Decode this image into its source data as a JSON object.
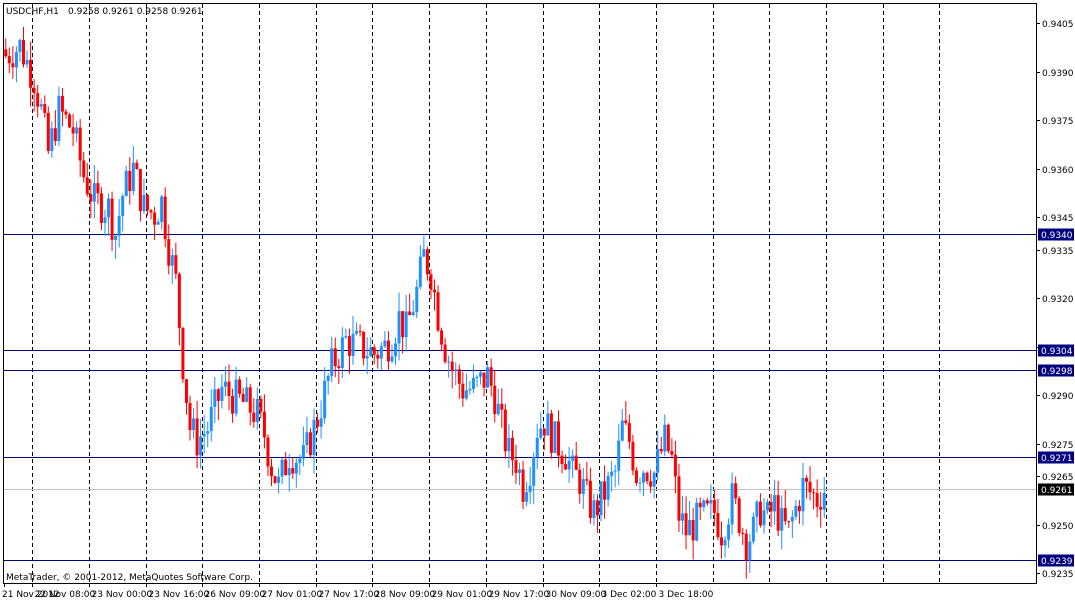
{
  "header": {
    "symbol_info": "USDCHF,H1",
    "ohlc": "0.9258 0.9261 0.9258 0.9261"
  },
  "footer": {
    "copyright": "MetaTrader, © 2001-2012, MetaQuotes Software Corp."
  },
  "colors": {
    "background": "#ffffff",
    "frame": "#000000",
    "bull": "#1e90ff",
    "bear": "#ff0000",
    "hline": "#000080",
    "current_price_line": "#c0c0c0",
    "current_price_tag": "#000000"
  },
  "chart_data": {
    "type": "candlestick",
    "ylim": [
      0.9232,
      0.9411
    ],
    "y_ticks": [
      "0.9405",
      "0.9390",
      "0.9375",
      "0.9360",
      "0.9345",
      "0.9335",
      "0.9320",
      "0.9305",
      "0.9290",
      "0.9275",
      "0.9265",
      "0.9250",
      "0.9235"
    ],
    "x_ticks": [
      "21 Nov 2012",
      "22 Nov 08:00",
      "23 Nov 00:00",
      "23 Nov 16:00",
      "26 Nov 09:00",
      "27 Nov 01:00",
      "27 Nov 17:00",
      "28 Nov 09:00",
      "29 Nov 01:00",
      "29 Nov 17:00",
      "30 Nov 09:00",
      "3 Dec 02:00",
      "3 Dec 18:00"
    ],
    "horizontal_lines": [
      "0.9340",
      "0.9304",
      "0.9298",
      "0.9271",
      "0.9239"
    ],
    "current_price": "0.9261",
    "close_path": [
      [
        0,
        0.9395
      ],
      [
        4,
        0.9398
      ],
      [
        8,
        0.9388
      ],
      [
        10,
        0.9378
      ],
      [
        12,
        0.9365
      ],
      [
        15,
        0.9378
      ],
      [
        19,
        0.9372
      ],
      [
        22,
        0.9358
      ],
      [
        25,
        0.935
      ],
      [
        29,
        0.9348
      ],
      [
        31,
        0.934
      ],
      [
        33,
        0.9352
      ],
      [
        36,
        0.936
      ],
      [
        39,
        0.9348
      ],
      [
        42,
        0.9346
      ],
      [
        44,
        0.935
      ],
      [
        46,
        0.9336
      ],
      [
        48,
        0.9325
      ],
      [
        50,
        0.93
      ],
      [
        52,
        0.928
      ],
      [
        54,
        0.9276
      ],
      [
        57,
        0.928
      ],
      [
        61,
        0.9292
      ],
      [
        65,
        0.9289
      ],
      [
        68,
        0.9287
      ],
      [
        71,
        0.9284
      ],
      [
        73,
        0.9278
      ],
      [
        75,
        0.9268
      ],
      [
        77,
        0.9262
      ],
      [
        80,
        0.9272
      ],
      [
        84,
        0.927
      ],
      [
        88,
        0.9283
      ],
      [
        92,
        0.9299
      ],
      [
        96,
        0.9307
      ],
      [
        100,
        0.9305
      ],
      [
        104,
        0.9303
      ],
      [
        107,
        0.9305
      ],
      [
        109,
        0.9308
      ],
      [
        111,
        0.9314
      ],
      [
        113,
        0.931
      ],
      [
        116,
        0.9322
      ],
      [
        118,
        0.9333
      ],
      [
        120,
        0.9328
      ],
      [
        122,
        0.9315
      ],
      [
        124,
        0.9305
      ],
      [
        126,
        0.9298
      ],
      [
        129,
        0.9292
      ],
      [
        132,
        0.9292
      ],
      [
        134,
        0.9294
      ],
      [
        136,
        0.9296
      ],
      [
        138,
        0.929
      ],
      [
        140,
        0.928
      ],
      [
        142,
        0.9272
      ],
      [
        144,
        0.927
      ],
      [
        146,
        0.9262
      ],
      [
        148,
        0.9268
      ],
      [
        150,
        0.928
      ],
      [
        152,
        0.9282
      ],
      [
        155,
        0.9276
      ],
      [
        158,
        0.9272
      ],
      [
        160,
        0.9266
      ],
      [
        162,
        0.9264
      ],
      [
        164,
        0.9258
      ],
      [
        166,
        0.9254
      ],
      [
        168,
        0.9258
      ],
      [
        170,
        0.9262
      ],
      [
        172,
        0.9266
      ],
      [
        174,
        0.928
      ],
      [
        176,
        0.9276
      ],
      [
        178,
        0.9266
      ],
      [
        180,
        0.9268
      ],
      [
        183,
        0.9266
      ],
      [
        186,
        0.9276
      ],
      [
        188,
        0.927
      ],
      [
        190,
        0.9253
      ],
      [
        192,
        0.9248
      ],
      [
        196,
        0.9252
      ],
      [
        200,
        0.9254
      ],
      [
        202,
        0.9248
      ],
      [
        205,
        0.9258
      ],
      [
        207,
        0.9252
      ],
      [
        209,
        0.9245
      ],
      [
        211,
        0.9248
      ],
      [
        213,
        0.9255
      ],
      [
        215,
        0.9252
      ],
      [
        217,
        0.9256
      ],
      [
        219,
        0.925
      ],
      [
        221,
        0.9248
      ],
      [
        223,
        0.9255
      ],
      [
        225,
        0.9262
      ],
      [
        227,
        0.926
      ],
      [
        229,
        0.9258
      ],
      [
        231,
        0.9261
      ]
    ],
    "candle_count": 232,
    "x_tick_every": 16,
    "x_tick_offset": 8
  }
}
